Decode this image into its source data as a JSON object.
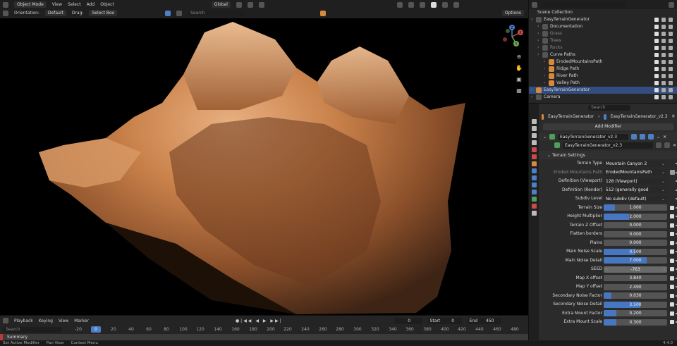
{
  "header": {
    "mode": "Object Mode",
    "menus": [
      "View",
      "Select",
      "Add",
      "Object"
    ],
    "transform_orientation": "Global",
    "orientation_label": "Orientation:",
    "orientation_value": "Default",
    "drag_label": "Drag:",
    "drag_value": "Select Box",
    "options": "Options",
    "search_placeholder": "Search"
  },
  "outliner": {
    "title": "Scene Collection",
    "rows": [
      {
        "label": "EasyTerrainGenerator",
        "indent": 1
      },
      {
        "label": "Documentation",
        "indent": 2
      },
      {
        "label": "Grass",
        "indent": 2,
        "dim": true
      },
      {
        "label": "Trees",
        "indent": 2,
        "dim": true
      },
      {
        "label": "Rocks",
        "indent": 2,
        "dim": true
      },
      {
        "label": "Curve Paths",
        "indent": 2
      },
      {
        "label": "ErodedMountainsPath",
        "indent": 3
      },
      {
        "label": "Ridge Path",
        "indent": 3
      },
      {
        "label": "River Path",
        "indent": 3
      },
      {
        "label": "Valley Path",
        "indent": 3
      },
      {
        "label": "EasyTerrainGenerator",
        "indent": 1,
        "selected": true
      },
      {
        "label": "Camera",
        "indent": 1
      }
    ]
  },
  "properties": {
    "search_placeholder": "Search",
    "breadcrumb_object": "EasyTerrainGenerator",
    "breadcrumb_modifier": "EasyTerrainGenerator_v2.3",
    "add_modifier": "Add Modifier",
    "modifier_name": "EasyTerrainGenerator_v2.3",
    "node_group": "EasyTerrainGenerator_v2.3",
    "panel_title": "Terrain Settings",
    "rows": [
      {
        "label": "Terrain Type",
        "kind": "menu",
        "value": "Mountain Canyon 2"
      },
      {
        "label": "Eroded Mountains Path",
        "kind": "menu",
        "value": "ErodedMountainsPath",
        "dim": true
      },
      {
        "label": "Definition (Viewport)",
        "kind": "menu",
        "value": "128 (Viewport)"
      },
      {
        "label": "Definition (Render)",
        "kind": "menu",
        "value": "512 (generally good enough)"
      },
      {
        "label": "Subdiv Level",
        "kind": "menu",
        "value": "No subdiv (default)"
      },
      {
        "label": "Terrain Size",
        "kind": "slider",
        "value": "1.000",
        "fill": 0.18
      },
      {
        "label": "Height Multiplier",
        "kind": "slider",
        "value": "2.000",
        "fill": 0.4
      },
      {
        "label": "Terrain Z Offset",
        "kind": "slider",
        "value": "0.000",
        "fill": 0
      },
      {
        "label": "Flatten borders",
        "kind": "slider",
        "value": "0.000",
        "fill": 0
      },
      {
        "label": "Plains",
        "kind": "slider",
        "value": "0.000",
        "fill": 0
      },
      {
        "label": "Main Noise Scale",
        "kind": "slider",
        "value": "0.500",
        "fill": 0.5
      },
      {
        "label": "Main Noise Detail",
        "kind": "slider",
        "value": "7.000",
        "fill": 0.68
      },
      {
        "label": "SEED",
        "kind": "seed",
        "value": "-763"
      },
      {
        "label": "Map X offset",
        "kind": "slider",
        "value": "3.840",
        "fill": 0
      },
      {
        "label": "Map Y offset",
        "kind": "slider",
        "value": "2.490",
        "fill": 0
      },
      {
        "label": "Secondary Noise Factor",
        "kind": "slider",
        "value": "0.030",
        "fill": 0.12
      },
      {
        "label": "Secondary Noise Detail",
        "kind": "slider",
        "value": "3.500",
        "fill": 0.58
      },
      {
        "label": "Extra Mount Factor",
        "kind": "slider",
        "value": "0.200",
        "fill": 0.2
      },
      {
        "label": "Extra Mount Scale",
        "kind": "slider",
        "value": "0.300",
        "fill": 0.2
      }
    ]
  },
  "timeline": {
    "menus": [
      "Playback",
      "Keying",
      "View",
      "Marker"
    ],
    "current_frame": "0",
    "current_field": "0",
    "start_label": "Start",
    "start": "0",
    "end_label": "End",
    "end": "450",
    "search_placeholder": "Search",
    "summary": "Summary",
    "ticks": [
      "-20",
      "20",
      "40",
      "60",
      "80",
      "100",
      "120",
      "140",
      "160",
      "180",
      "200",
      "220",
      "240",
      "260",
      "280",
      "300",
      "320",
      "340",
      "360",
      "380",
      "400",
      "420",
      "440",
      "460",
      "480"
    ]
  },
  "statusbar": {
    "items": [
      "Set Active Modifier",
      "Pan View",
      "Context Menu"
    ],
    "version": "4.4.0"
  },
  "gizmo": {
    "x": "X",
    "y": "Y",
    "z": "Z"
  },
  "colors": {
    "accent": "#4877c1",
    "selected_row": "#334d80",
    "terrain": "#c9814a"
  }
}
